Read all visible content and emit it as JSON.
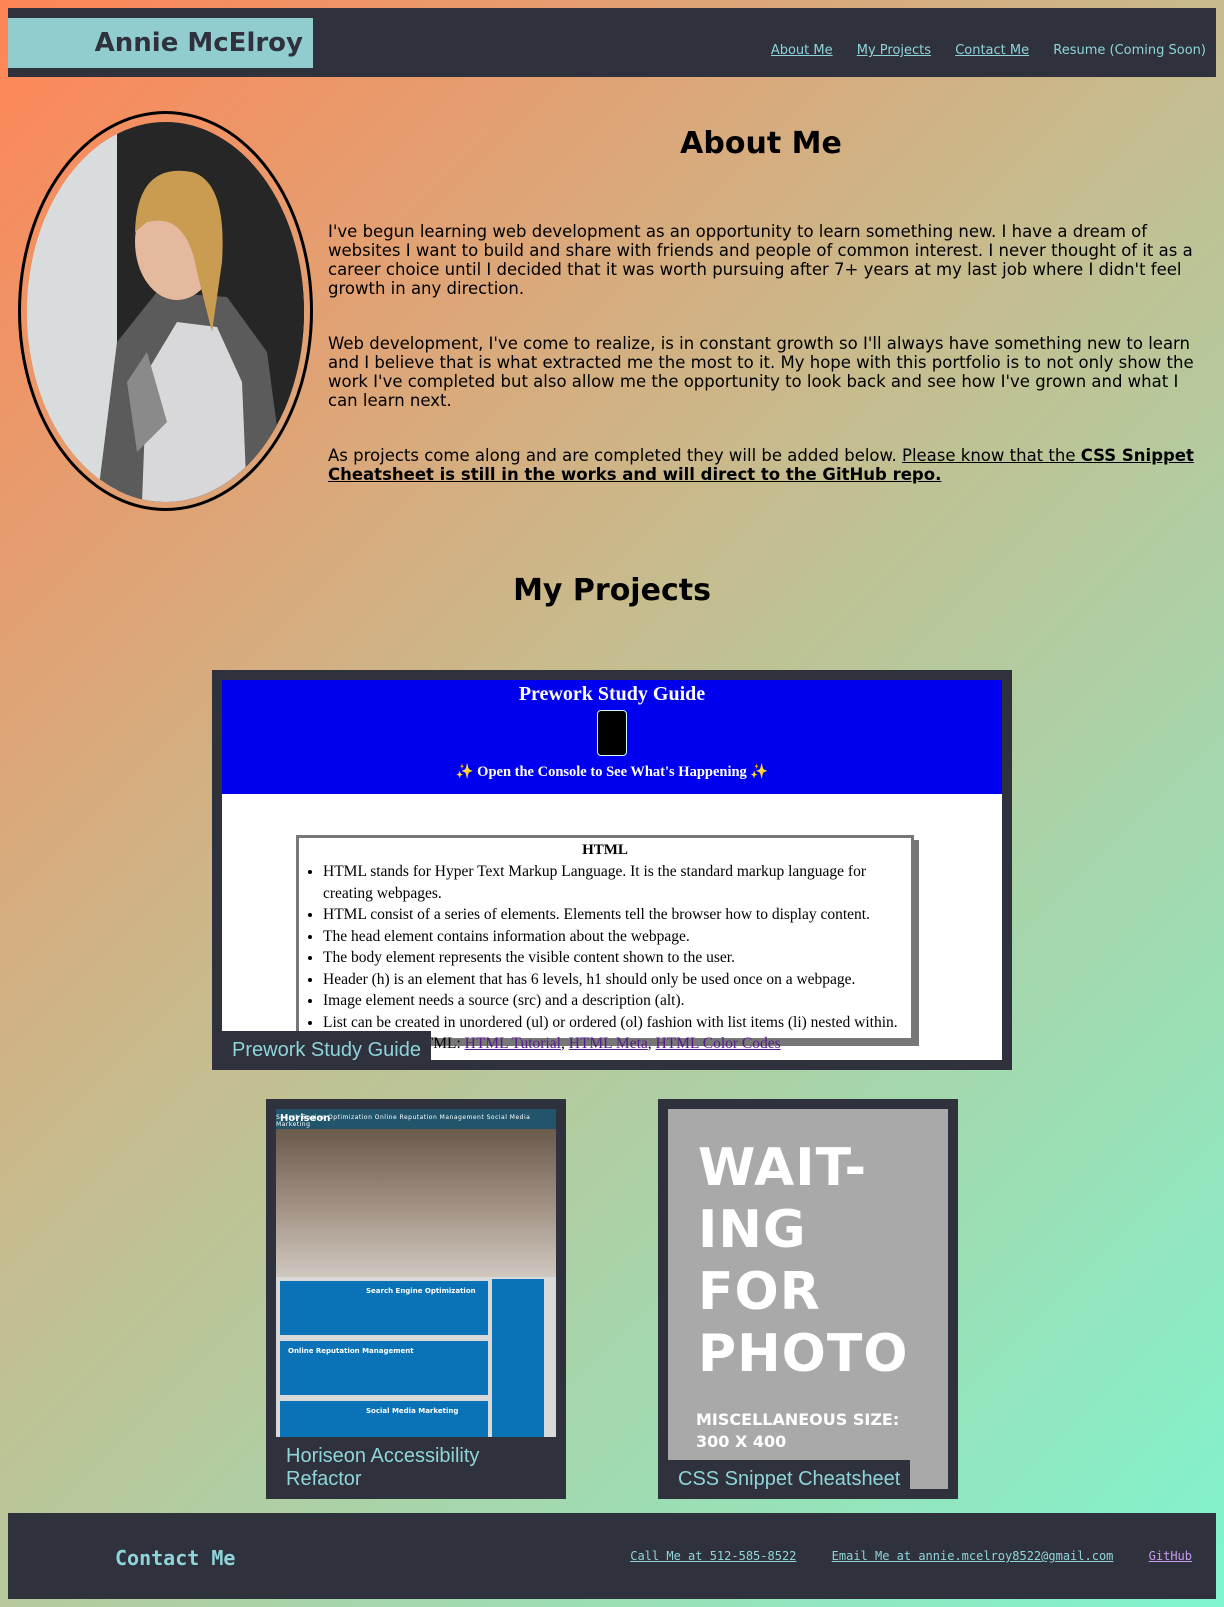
{
  "header": {
    "brand": "Annie McElroy",
    "nav": [
      "About Me",
      "My Projects",
      "Contact Me"
    ],
    "nav_plain": "Resume (Coming Soon)"
  },
  "about": {
    "title": "About Me",
    "p1": "I've begun learning web development as an opportunity to learn something new. I have a dream of websites I want to build and share with friends and people of common interest. I never thought of it as a career choice until I decided that it was worth pursuing after 7+ years at my last job where I didn't feel growth in any direction.",
    "p2": "Web development, I've come to realize, is in constant growth so I'll always have something new to learn and I believe that is what extracted me the most to it. My hope with this portfolio is to not only show the work I've completed but also allow me the opportunity to look back and see how I've grown and what I can learn next.",
    "p3_lead": "As projects come along and are completed they will be added below. ",
    "p3_note_a": "Please know that the ",
    "p3_note_b": "CSS Snippet Cheatsheet is still in the works and will direct to the GitHub repo."
  },
  "projects": {
    "title": "My Projects",
    "prework": {
      "label": "Prework Study Guide",
      "banner_title": "Prework Study Guide",
      "banner_sub": "✨ Open the Console to See What's Happening ✨",
      "box_title": "HTML",
      "items": [
        "HTML stands for Hyper Text Markup Language. It is the standard markup language for creating webpages.",
        "HTML consist of a series of elements. Elements tell the browser how to display content.",
        "The head element contains information about the webpage.",
        "The body element represents the visible content shown to the user.",
        "Header (h) is an element that has 6 levels, h1 should only be used once on a webpage.",
        "Image element needs a source (src) and a description (alt).",
        "List can be created in unordered (ul) or ordered (ol) fashion with list items (li) nested within."
      ],
      "resources_lead": "Resources for HTML: ",
      "resources": [
        "HTML Tutorial",
        "HTML Meta",
        "HTML Color Codes"
      ]
    },
    "horiseon": {
      "label": "Horiseon Accessibility Refactor",
      "logo": "Horiseon",
      "nav": "Search Engine Optimization     Online Reputation Management     Social Media Marketing",
      "blocks": [
        "Search Engine Optimization",
        "Online Reputation Management",
        "Social Media Marketing"
      ]
    },
    "snippet": {
      "label": "CSS Snippet Cheatsheet",
      "placeholder_big": [
        "WAIT-",
        "ING",
        "FOR",
        "PHOTO"
      ],
      "placeholder_small": [
        "MISCELLANEOUS SIZE:",
        "300 X 400"
      ]
    }
  },
  "footer": {
    "title": "Contact Me",
    "links": [
      "Call Me at 512-585-8522",
      "Email Me at annie.mcelroy8522@gmail.com",
      "GitHub"
    ]
  },
  "colors": {
    "dark": "#2f323d",
    "accent": "#91cccf",
    "gradient_start": "#ff8456",
    "gradient_end": "#7ff5cf"
  }
}
